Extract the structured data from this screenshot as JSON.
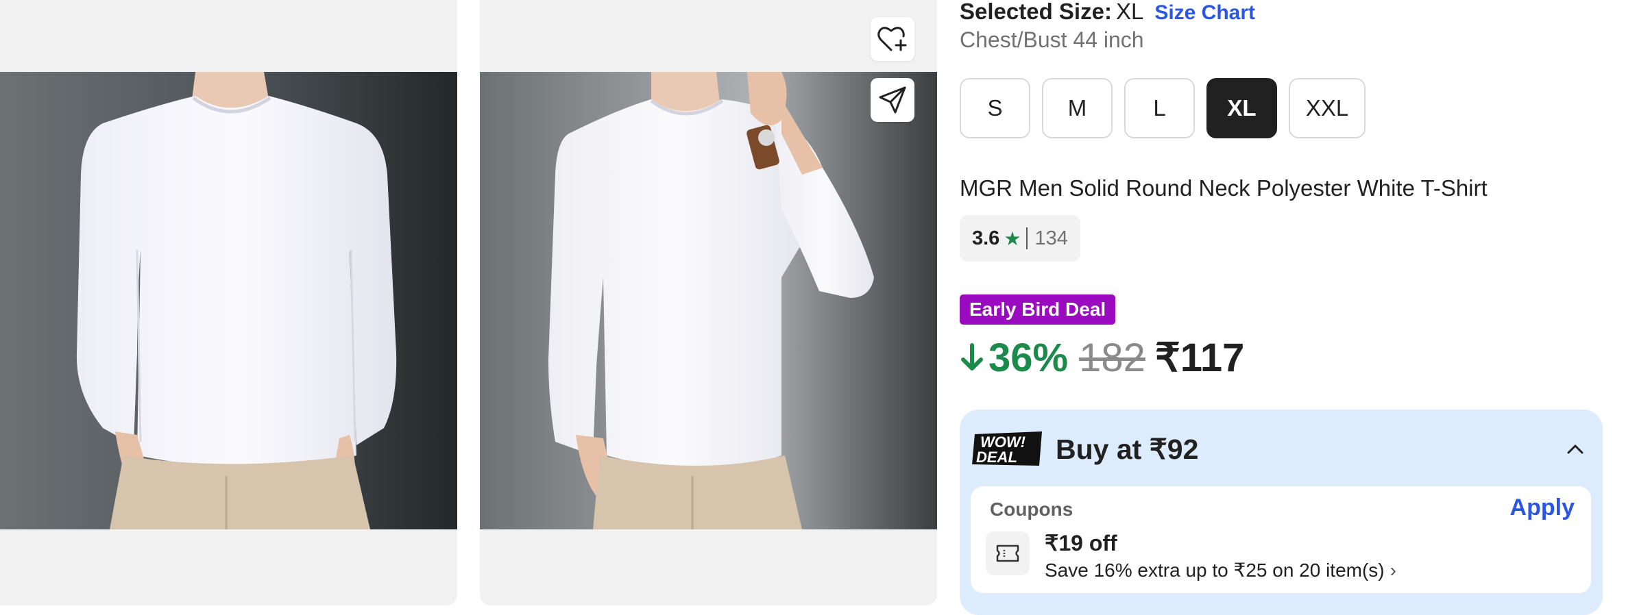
{
  "gallery": {
    "images": [
      {
        "alt": "Man wearing white long sleeve t-shirt, front view"
      },
      {
        "alt": "Man wearing white long sleeve t-shirt, hand on shoulder"
      }
    ],
    "wishlist_icon": "heart-plus-icon",
    "share_icon": "paper-plane-icon"
  },
  "size": {
    "selected_label": "Selected Size:",
    "selected_value": "XL",
    "chart_link": "Size Chart",
    "measurement": "Chest/Bust 44 inch",
    "options": [
      "S",
      "M",
      "L",
      "XL",
      "XXL"
    ],
    "selected_index": 3
  },
  "product": {
    "title": "MGR Men Solid Round Neck Polyester White T-Shirt",
    "rating": "3.6",
    "rating_count": "134"
  },
  "deal": {
    "badge": "Early Bird Deal",
    "discount": "36%",
    "mrp": "182",
    "price": "₹117"
  },
  "wow_deal": {
    "logo_line1": "WOW!",
    "logo_line2": "DEAL",
    "title": "Buy at ₹92",
    "coupons_header": "Coupons",
    "apply_label": "Apply",
    "coupon_offer": "₹19 off",
    "coupon_desc": "Save 16% extra up to ₹25 on 20 item(s)"
  },
  "colors": {
    "accent_blue": "#2a55e5",
    "discount_green": "#1b8a4a",
    "deal_purple": "#9a0bc0",
    "wow_bg": "#dcecfc",
    "selected_size_bg": "#212121"
  }
}
